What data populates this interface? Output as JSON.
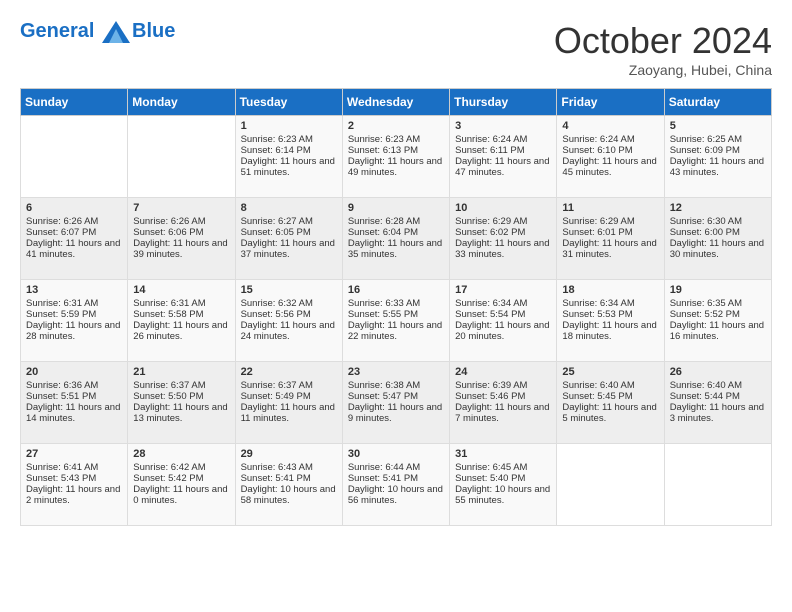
{
  "header": {
    "logo_line1": "General",
    "logo_line2": "Blue",
    "month": "October 2024",
    "location": "Zaoyang, Hubei, China"
  },
  "days_of_week": [
    "Sunday",
    "Monday",
    "Tuesday",
    "Wednesday",
    "Thursday",
    "Friday",
    "Saturday"
  ],
  "weeks": [
    [
      {
        "day": "",
        "sunrise": "",
        "sunset": "",
        "daylight": ""
      },
      {
        "day": "",
        "sunrise": "",
        "sunset": "",
        "daylight": ""
      },
      {
        "day": "1",
        "sunrise": "Sunrise: 6:23 AM",
        "sunset": "Sunset: 6:14 PM",
        "daylight": "Daylight: 11 hours and 51 minutes."
      },
      {
        "day": "2",
        "sunrise": "Sunrise: 6:23 AM",
        "sunset": "Sunset: 6:13 PM",
        "daylight": "Daylight: 11 hours and 49 minutes."
      },
      {
        "day": "3",
        "sunrise": "Sunrise: 6:24 AM",
        "sunset": "Sunset: 6:11 PM",
        "daylight": "Daylight: 11 hours and 47 minutes."
      },
      {
        "day": "4",
        "sunrise": "Sunrise: 6:24 AM",
        "sunset": "Sunset: 6:10 PM",
        "daylight": "Daylight: 11 hours and 45 minutes."
      },
      {
        "day": "5",
        "sunrise": "Sunrise: 6:25 AM",
        "sunset": "Sunset: 6:09 PM",
        "daylight": "Daylight: 11 hours and 43 minutes."
      }
    ],
    [
      {
        "day": "6",
        "sunrise": "Sunrise: 6:26 AM",
        "sunset": "Sunset: 6:07 PM",
        "daylight": "Daylight: 11 hours and 41 minutes."
      },
      {
        "day": "7",
        "sunrise": "Sunrise: 6:26 AM",
        "sunset": "Sunset: 6:06 PM",
        "daylight": "Daylight: 11 hours and 39 minutes."
      },
      {
        "day": "8",
        "sunrise": "Sunrise: 6:27 AM",
        "sunset": "Sunset: 6:05 PM",
        "daylight": "Daylight: 11 hours and 37 minutes."
      },
      {
        "day": "9",
        "sunrise": "Sunrise: 6:28 AM",
        "sunset": "Sunset: 6:04 PM",
        "daylight": "Daylight: 11 hours and 35 minutes."
      },
      {
        "day": "10",
        "sunrise": "Sunrise: 6:29 AM",
        "sunset": "Sunset: 6:02 PM",
        "daylight": "Daylight: 11 hours and 33 minutes."
      },
      {
        "day": "11",
        "sunrise": "Sunrise: 6:29 AM",
        "sunset": "Sunset: 6:01 PM",
        "daylight": "Daylight: 11 hours and 31 minutes."
      },
      {
        "day": "12",
        "sunrise": "Sunrise: 6:30 AM",
        "sunset": "Sunset: 6:00 PM",
        "daylight": "Daylight: 11 hours and 30 minutes."
      }
    ],
    [
      {
        "day": "13",
        "sunrise": "Sunrise: 6:31 AM",
        "sunset": "Sunset: 5:59 PM",
        "daylight": "Daylight: 11 hours and 28 minutes."
      },
      {
        "day": "14",
        "sunrise": "Sunrise: 6:31 AM",
        "sunset": "Sunset: 5:58 PM",
        "daylight": "Daylight: 11 hours and 26 minutes."
      },
      {
        "day": "15",
        "sunrise": "Sunrise: 6:32 AM",
        "sunset": "Sunset: 5:56 PM",
        "daylight": "Daylight: 11 hours and 24 minutes."
      },
      {
        "day": "16",
        "sunrise": "Sunrise: 6:33 AM",
        "sunset": "Sunset: 5:55 PM",
        "daylight": "Daylight: 11 hours and 22 minutes."
      },
      {
        "day": "17",
        "sunrise": "Sunrise: 6:34 AM",
        "sunset": "Sunset: 5:54 PM",
        "daylight": "Daylight: 11 hours and 20 minutes."
      },
      {
        "day": "18",
        "sunrise": "Sunrise: 6:34 AM",
        "sunset": "Sunset: 5:53 PM",
        "daylight": "Daylight: 11 hours and 18 minutes."
      },
      {
        "day": "19",
        "sunrise": "Sunrise: 6:35 AM",
        "sunset": "Sunset: 5:52 PM",
        "daylight": "Daylight: 11 hours and 16 minutes."
      }
    ],
    [
      {
        "day": "20",
        "sunrise": "Sunrise: 6:36 AM",
        "sunset": "Sunset: 5:51 PM",
        "daylight": "Daylight: 11 hours and 14 minutes."
      },
      {
        "day": "21",
        "sunrise": "Sunrise: 6:37 AM",
        "sunset": "Sunset: 5:50 PM",
        "daylight": "Daylight: 11 hours and 13 minutes."
      },
      {
        "day": "22",
        "sunrise": "Sunrise: 6:37 AM",
        "sunset": "Sunset: 5:49 PM",
        "daylight": "Daylight: 11 hours and 11 minutes."
      },
      {
        "day": "23",
        "sunrise": "Sunrise: 6:38 AM",
        "sunset": "Sunset: 5:47 PM",
        "daylight": "Daylight: 11 hours and 9 minutes."
      },
      {
        "day": "24",
        "sunrise": "Sunrise: 6:39 AM",
        "sunset": "Sunset: 5:46 PM",
        "daylight": "Daylight: 11 hours and 7 minutes."
      },
      {
        "day": "25",
        "sunrise": "Sunrise: 6:40 AM",
        "sunset": "Sunset: 5:45 PM",
        "daylight": "Daylight: 11 hours and 5 minutes."
      },
      {
        "day": "26",
        "sunrise": "Sunrise: 6:40 AM",
        "sunset": "Sunset: 5:44 PM",
        "daylight": "Daylight: 11 hours and 3 minutes."
      }
    ],
    [
      {
        "day": "27",
        "sunrise": "Sunrise: 6:41 AM",
        "sunset": "Sunset: 5:43 PM",
        "daylight": "Daylight: 11 hours and 2 minutes."
      },
      {
        "day": "28",
        "sunrise": "Sunrise: 6:42 AM",
        "sunset": "Sunset: 5:42 PM",
        "daylight": "Daylight: 11 hours and 0 minutes."
      },
      {
        "day": "29",
        "sunrise": "Sunrise: 6:43 AM",
        "sunset": "Sunset: 5:41 PM",
        "daylight": "Daylight: 10 hours and 58 minutes."
      },
      {
        "day": "30",
        "sunrise": "Sunrise: 6:44 AM",
        "sunset": "Sunset: 5:41 PM",
        "daylight": "Daylight: 10 hours and 56 minutes."
      },
      {
        "day": "31",
        "sunrise": "Sunrise: 6:45 AM",
        "sunset": "Sunset: 5:40 PM",
        "daylight": "Daylight: 10 hours and 55 minutes."
      },
      {
        "day": "",
        "sunrise": "",
        "sunset": "",
        "daylight": ""
      },
      {
        "day": "",
        "sunrise": "",
        "sunset": "",
        "daylight": ""
      }
    ]
  ]
}
